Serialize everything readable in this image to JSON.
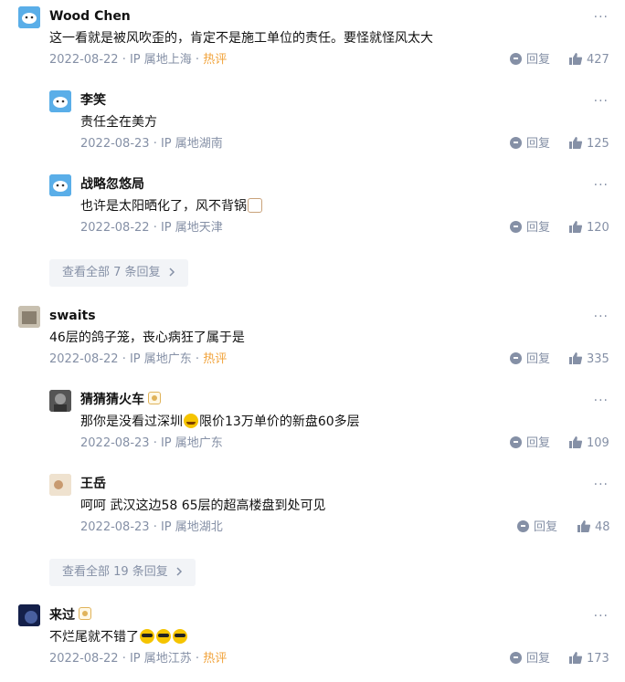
{
  "icons": {
    "reply": "reply-icon",
    "like": "thumbs-up-icon",
    "more": "more-dots-icon",
    "chevron": "chevron-right-icon"
  },
  "colors": {
    "meta": "#8590a6",
    "hot": "#f1a33b",
    "view_all_bg": "#f2f4f7"
  },
  "more_label": "···",
  "reply_label": "回复",
  "threads": [
    {
      "author": "Wood Chen",
      "content": "这一看就是被风吹歪的，肯定不是施工单位的责任。要怪就怪风太大",
      "date": "2022-08-22",
      "location": "IP 属地上海",
      "hot": "热评",
      "likes": "427",
      "replies": [
        {
          "author": "李笑",
          "content": "责任全在美方",
          "date": "2022-08-23",
          "location": "IP 属地湖南",
          "likes": "125"
        },
        {
          "author": "战略忽悠局",
          "content": "也许是太阳晒化了，风不背锅",
          "date": "2022-08-22",
          "location": "IP 属地天津",
          "likes": "120"
        }
      ],
      "view_all": "查看全部 7 条回复"
    },
    {
      "author": "swaits",
      "content": "46层的鸽子笼，丧心病狂了属于是",
      "date": "2022-08-22",
      "location": "IP 属地广东",
      "hot": "热评",
      "likes": "335",
      "replies": [
        {
          "author": "猜猜猜火车",
          "content_a": "那你是没看过深圳",
          "content_b": "限价13万单价的新盘60多层",
          "date": "2022-08-23",
          "location": "IP 属地广东",
          "likes": "109"
        },
        {
          "author": "王岳",
          "content": "呵呵 武汉这边58 65层的超高楼盘到处可见",
          "date": "2022-08-23",
          "location": "IP 属地湖北",
          "likes": "48"
        }
      ],
      "view_all": "查看全部 19 条回复"
    },
    {
      "author": "来过",
      "content": "不烂尾就不错了",
      "date": "2022-08-22",
      "location": "IP 属地江苏",
      "hot": "热评",
      "likes": "173"
    }
  ]
}
